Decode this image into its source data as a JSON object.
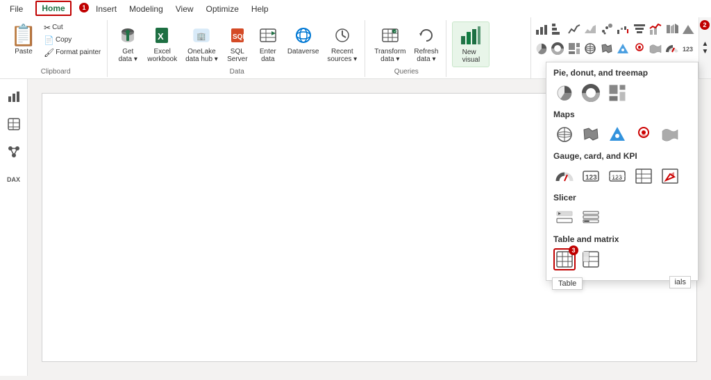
{
  "menubar": {
    "items": [
      {
        "id": "file",
        "label": "File"
      },
      {
        "id": "home",
        "label": "Home",
        "active": true,
        "badge": "1"
      },
      {
        "id": "insert",
        "label": "Insert"
      },
      {
        "id": "modeling",
        "label": "Modeling"
      },
      {
        "id": "view",
        "label": "View"
      },
      {
        "id": "optimize",
        "label": "Optimize"
      },
      {
        "id": "help",
        "label": "Help"
      }
    ]
  },
  "ribbon": {
    "groups": [
      {
        "id": "clipboard",
        "label": "Clipboard",
        "buttons": [
          {
            "id": "paste",
            "label": "Paste",
            "icon": "📋"
          },
          {
            "id": "cut",
            "label": "Cut",
            "icon": "✂️"
          },
          {
            "id": "copy",
            "label": "Copy",
            "icon": "📄"
          },
          {
            "id": "format-painter",
            "label": "Format painter",
            "icon": "🖌️"
          }
        ]
      },
      {
        "id": "data",
        "label": "Data",
        "buttons": [
          {
            "id": "get-data",
            "label": "Get data",
            "icon": "🗄️",
            "hasDropdown": true
          },
          {
            "id": "excel-workbook",
            "label": "Excel workbook",
            "icon": "📗",
            "hasDropdown": false
          },
          {
            "id": "onelake-data-hub",
            "label": "OneLake data hub",
            "icon": "🏢",
            "hasDropdown": true
          },
          {
            "id": "sql-server",
            "label": "SQL Server",
            "icon": "🖥️"
          },
          {
            "id": "enter-data",
            "label": "Enter data",
            "icon": "📝"
          },
          {
            "id": "dataverse",
            "label": "Dataverse",
            "icon": "⊙"
          },
          {
            "id": "recent-sources",
            "label": "Recent sources",
            "icon": "🕐",
            "hasDropdown": true
          }
        ]
      },
      {
        "id": "queries",
        "label": "Queries",
        "buttons": [
          {
            "id": "transform",
            "label": "Transform data",
            "icon": "⚙️",
            "hasDropdown": true
          },
          {
            "id": "refresh",
            "label": "Refresh data",
            "icon": "🔄",
            "hasDropdown": true
          }
        ]
      },
      {
        "id": "visuals",
        "label": "",
        "buttons": [
          {
            "id": "new-visual",
            "label": "New visual",
            "icon": "📊"
          }
        ]
      }
    ]
  },
  "viz_panel": {
    "badge": "2",
    "row1": [
      "📊",
      "📈",
      "📉",
      "📊",
      "📊",
      "📊",
      "📈",
      "📈",
      "📈",
      "📉"
    ],
    "row2": [
      "🥧",
      "⬡",
      "⬡",
      "🗺️",
      "🗺️",
      "🗺️",
      "🗺️",
      "🗺️",
      "📻",
      "📻"
    ],
    "sections": [
      {
        "title": "Pie, donut, and treemap",
        "icons": [
          "🥧",
          "⬡",
          "▦"
        ]
      },
      {
        "title": "Maps",
        "icons": [
          "🌐",
          "🗺️",
          "▲",
          "📍",
          "🗺️"
        ]
      },
      {
        "title": "Gauge, card, and KPI",
        "icons": [
          "📻",
          "123",
          "123",
          "☰",
          "▲"
        ]
      },
      {
        "title": "Slicer",
        "icons": [
          "⚡",
          "☰"
        ]
      },
      {
        "title": "Table and matrix",
        "icons": [
          "⊞",
          "⊞"
        ]
      }
    ]
  },
  "tooltip": {
    "table_label": "Table",
    "badge3": "3"
  },
  "sidebar_left": {
    "icons": [
      {
        "id": "report-view",
        "icon": "📊"
      },
      {
        "id": "table-view",
        "icon": "⊞"
      },
      {
        "id": "model-view",
        "icon": "🔗"
      },
      {
        "id": "dax-explorer",
        "icon": "DAX"
      }
    ]
  }
}
